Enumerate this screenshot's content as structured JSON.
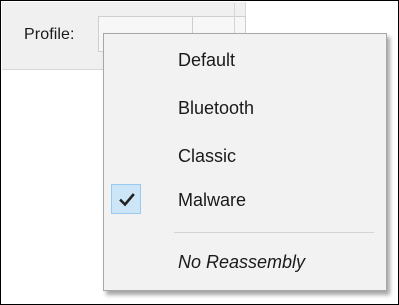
{
  "toolbar": {
    "profile_label": "Profile:"
  },
  "profile_menu": {
    "items": [
      {
        "label": "Default",
        "checked": false
      },
      {
        "label": "Bluetooth",
        "checked": false
      },
      {
        "label": "Classic",
        "checked": false
      },
      {
        "label": "Malware",
        "checked": true
      }
    ],
    "extra_item": {
      "label": "No Reassembly",
      "style": "italic"
    },
    "check_icon": "checkmark-icon"
  },
  "colors": {
    "menu_background": "#f2f2f2",
    "check_highlight": "#cde6f7",
    "check_border": "#99c9ef",
    "text": "#1a1a1a"
  }
}
